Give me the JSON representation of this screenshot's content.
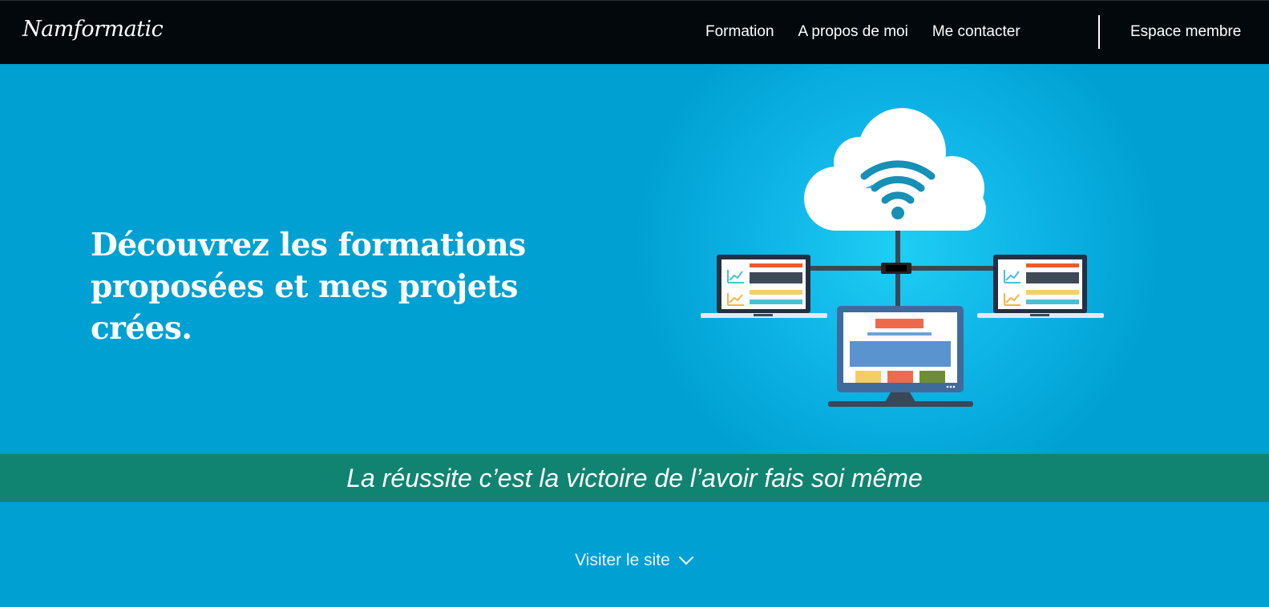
{
  "navbar": {
    "brand": "Namformatic",
    "links": [
      {
        "label": "Formation"
      },
      {
        "label": "A propos de moi"
      },
      {
        "label": "Me contacter"
      }
    ],
    "member_link": "Espace membre"
  },
  "hero": {
    "title": "Découvrez les formations proposées et mes projets crées.",
    "illustration": "cloud-network-icon"
  },
  "quote": {
    "text": "La réussite c’est la victoire de l’avoir fais soi même"
  },
  "visit": {
    "label": "Visiter le site",
    "icon": "chevron-down-icon"
  },
  "colors": {
    "navbar_bg": "#02080c",
    "hero_bg": "#00a0d2",
    "quote_band_bg": "#108471",
    "text": "#ffffff"
  }
}
